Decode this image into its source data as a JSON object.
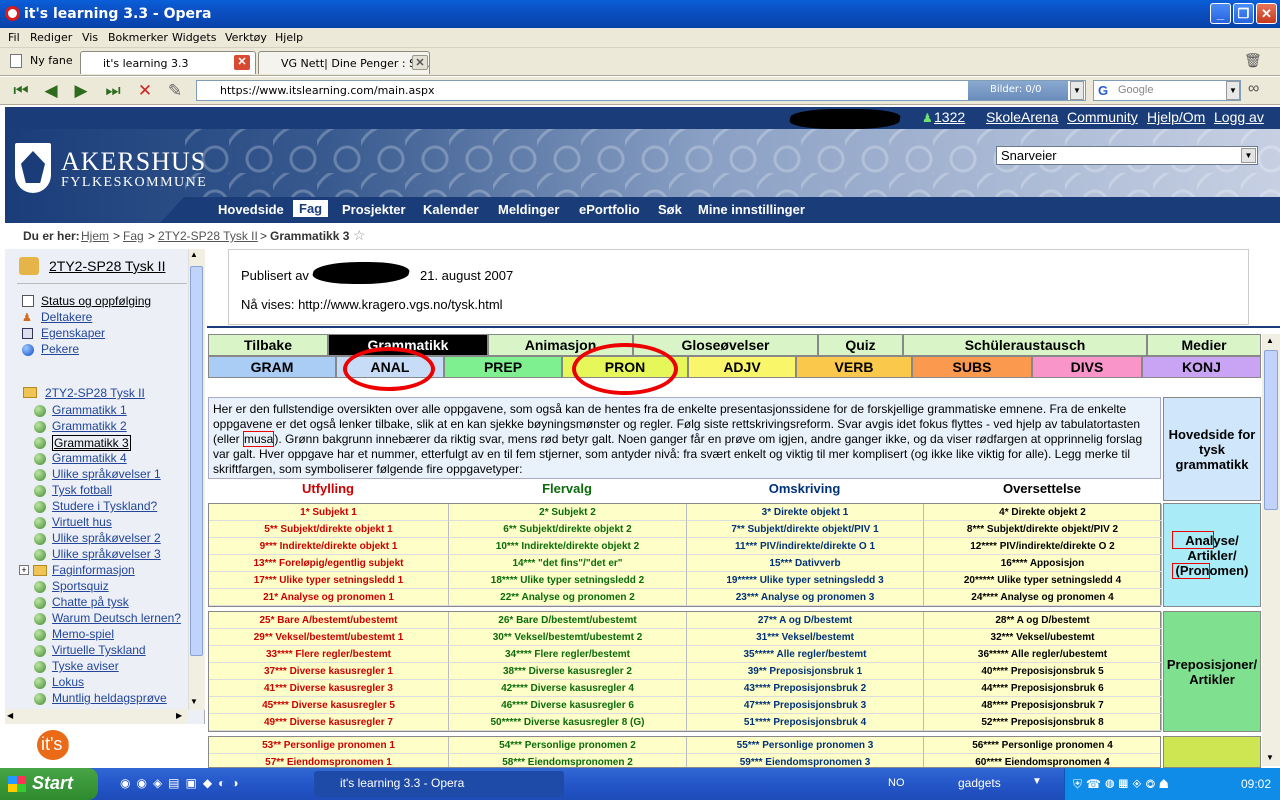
{
  "window": {
    "title": "it's learning 3.3 - Opera"
  },
  "menu": [
    "Fil",
    "Rediger",
    "Vis",
    "Bokmerker",
    "Widgets",
    "Verktøy",
    "Hjelp"
  ],
  "tabs": [
    {
      "label": "Ny fane"
    },
    {
      "label": "it's learning 3.3"
    },
    {
      "label": "VG Nett| Dine Penger : Sl..."
    }
  ],
  "nav": {
    "url": "https://www.itslearning.com/main.aspx",
    "bilder": "Bilder:  0/0",
    "search_placeholder": "Google"
  },
  "site": {
    "count": "1322",
    "toplinks": [
      "SkoleArena",
      "Community",
      "Hjelp/Om",
      "Logg av"
    ],
    "logo_line1": "AKERSHUS",
    "logo_line2": "FYLKESKOMMUNE",
    "shortcuts": "Snarveier",
    "mainnav": [
      "Hovedside",
      "Fag",
      "Prosjekter",
      "Kalender",
      "Meldinger",
      "ePortfolio",
      "Søk",
      "Mine innstillinger"
    ],
    "breadcrumb": {
      "prefix": "Du er her:",
      "hjem": "Hjem",
      "fag": "Fag",
      "course": "2TY2-SP28 Tysk II",
      "current": "Grammatikk 3"
    }
  },
  "sidebar": {
    "course_title": "2TY2-SP28 Tysk II",
    "links": [
      "Status og oppfølging",
      "Deltakere",
      "Egenskaper",
      "Pekere"
    ],
    "folder": "2TY2-SP28 Tysk II",
    "items": [
      "Grammatikk 1",
      "Grammatikk 2",
      "Grammatikk 3",
      "Grammatikk 4",
      "Ulike språkøvelser 1",
      "Tysk fotball",
      "Studere i Tyskland?",
      "Virtuelt hus",
      "Ulike språkøvelser 2",
      "Ulike språkøvelser 3",
      "Faginformasjon",
      "Sportsquiz",
      "Chatte på tysk",
      "Warum Deutsch lernen?",
      "Memo-spiel",
      "Virtuelle Tyskland",
      "Tyske aviser",
      "Lokus",
      "Muntlig heldagsprøve"
    ],
    "footer_logo": "it's learning"
  },
  "content": {
    "published_prefix": "Publisert av",
    "published_date": "21. august 2007",
    "showing": "Nå vises: http://www.kragero.vgs.no/tysk.html",
    "maintabs": [
      "Tilbake",
      "Grammatikk",
      "Animasjon",
      "Gloseøvelser",
      "Quiz",
      "Schüleraustausch",
      "Medier"
    ],
    "cattabs": [
      "GRAM",
      "ANAL",
      "PREP",
      "PRON",
      "ADJV",
      "VERB",
      "SUBS",
      "DIVS",
      "KONJ"
    ],
    "intro_before": "Her er den fullstendige oversikten over alle oppgavene, som også kan de hentes fra de enkelte presentasjonssidene for de forskjellige grammatiske emnene. Fra de enkelte oppgavene er det også lenker tilbake, slik at en kan sjekke bøyningsmønster og regler. Følg siste rettskrivingsreform. Svar avgis idet fokus flyttes - ved hjelp av tabulatortasten (eller",
    "intro_musa": "musa",
    "intro_after": "). Grønn bakgrunn innebærer da riktig svar, mens rød betyr galt. Noen ganger får en prøve om igjen, andre ganger ikke, og da viser rødfargen at opprinnelig forslag var galt. Hver oppgave har et nummer, etterfulgt av en til fem stjerner, som antyder nivå: fra svært enkelt og viktig til mer komplisert (og ikke like viktig for alle). Legg merke til skriftfargen, som symboliserer følgende fire oppgavetyper:",
    "hovedside": "Hovedside for tysk grammatikk",
    "colheads": [
      "Utfylling",
      "Flervalg",
      "Omskriving",
      "Oversettelse"
    ],
    "group1_label": "Analyse/ Artikler/ (Pronomen)",
    "group2_label": "Preposisjoner/ Artikler",
    "group1": [
      [
        "1* Subjekt 1",
        "2* Subjekt 2",
        "3* Direkte objekt 1",
        "4* Direkte objekt 2"
      ],
      [
        "5** Subjekt/direkte objekt 1",
        "6** Subjekt/direkte objekt 2",
        "7** Subjekt/direkte objekt/PIV 1",
        "8*** Subjekt/direkte objekt/PIV 2"
      ],
      [
        "9*** Indirekte/direkte objekt 1",
        "10*** Indirekte/direkte objekt 2",
        "11*** PIV/indirekte/direkte O 1",
        "12**** PIV/indirekte/direkte O 2"
      ],
      [
        "13*** Foreløpig/egentlig subjekt",
        "14*** \"det fins\"/\"det er\"",
        "15*** Dativverb",
        "16**** Apposisjon"
      ],
      [
        "17*** Ulike typer setningsledd 1",
        "18**** Ulike typer setningsledd 2",
        "19***** Ulike typer setningsledd 3",
        "20***** Ulike typer setningsledd 4"
      ],
      [
        "21* Analyse og pronomen 1",
        "22** Analyse og pronomen 2",
        "23*** Analyse og pronomen 3",
        "24**** Analyse og pronomen 4"
      ]
    ],
    "group2": [
      [
        "25* Bare A/bestemt/ubestemt",
        "26* Bare D/bestemt/ubestemt",
        "27** A og D/bestemt",
        "28** A og D/bestemt"
      ],
      [
        "29** Veksel/bestemt/ubestemt 1",
        "30** Veksel/bestemt/ubestemt 2",
        "31*** Veksel/bestemt",
        "32*** Veksel/ubestemt"
      ],
      [
        "33**** Flere regler/bestemt",
        "34**** Flere regler/bestemt",
        "35***** Alle regler/bestemt",
        "36***** Alle regler/ubestemt"
      ],
      [
        "37*** Diverse kasusregler 1",
        "38*** Diverse kasusregler 2",
        "39** Preposisjonsbruk 1",
        "40**** Preposisjonsbruk 5"
      ],
      [
        "41*** Diverse kasusregler 3",
        "42**** Diverse kasusregler 4",
        "43**** Preposisjonsbruk 2",
        "44**** Preposisjonsbruk 6"
      ],
      [
        "45**** Diverse kasusregler 5",
        "46**** Diverse kasusregler 6",
        "47**** Preposisjonsbruk 3",
        "48**** Preposisjonsbruk 7"
      ],
      [
        "49*** Diverse kasusregler 7",
        "50***** Diverse kasusregler 8 (G)",
        "51**** Preposisjonsbruk 4",
        "52**** Preposisjonsbruk 8"
      ]
    ],
    "group3": [
      [
        "53** Personlige pronomen 1",
        "54*** Personlige pronomen 2",
        "55*** Personlige pronomen 3",
        "56**** Personlige pronomen 4"
      ],
      [
        "57** Eiendomspronomen 1",
        "58*** Eiendomspronomen 2",
        "59*** Eiendomspronomen 3",
        "60**** Eiendomspronomen 4"
      ]
    ]
  },
  "taskbar": {
    "start": "Start",
    "task": "it's learning 3.3 - Opera",
    "lang": "NO",
    "gadgets": "gadgets",
    "time": "09:02"
  },
  "colors": {
    "navy": "#1a3d7a",
    "green_tab": "#d9f5c8",
    "ring": "#e00000"
  }
}
